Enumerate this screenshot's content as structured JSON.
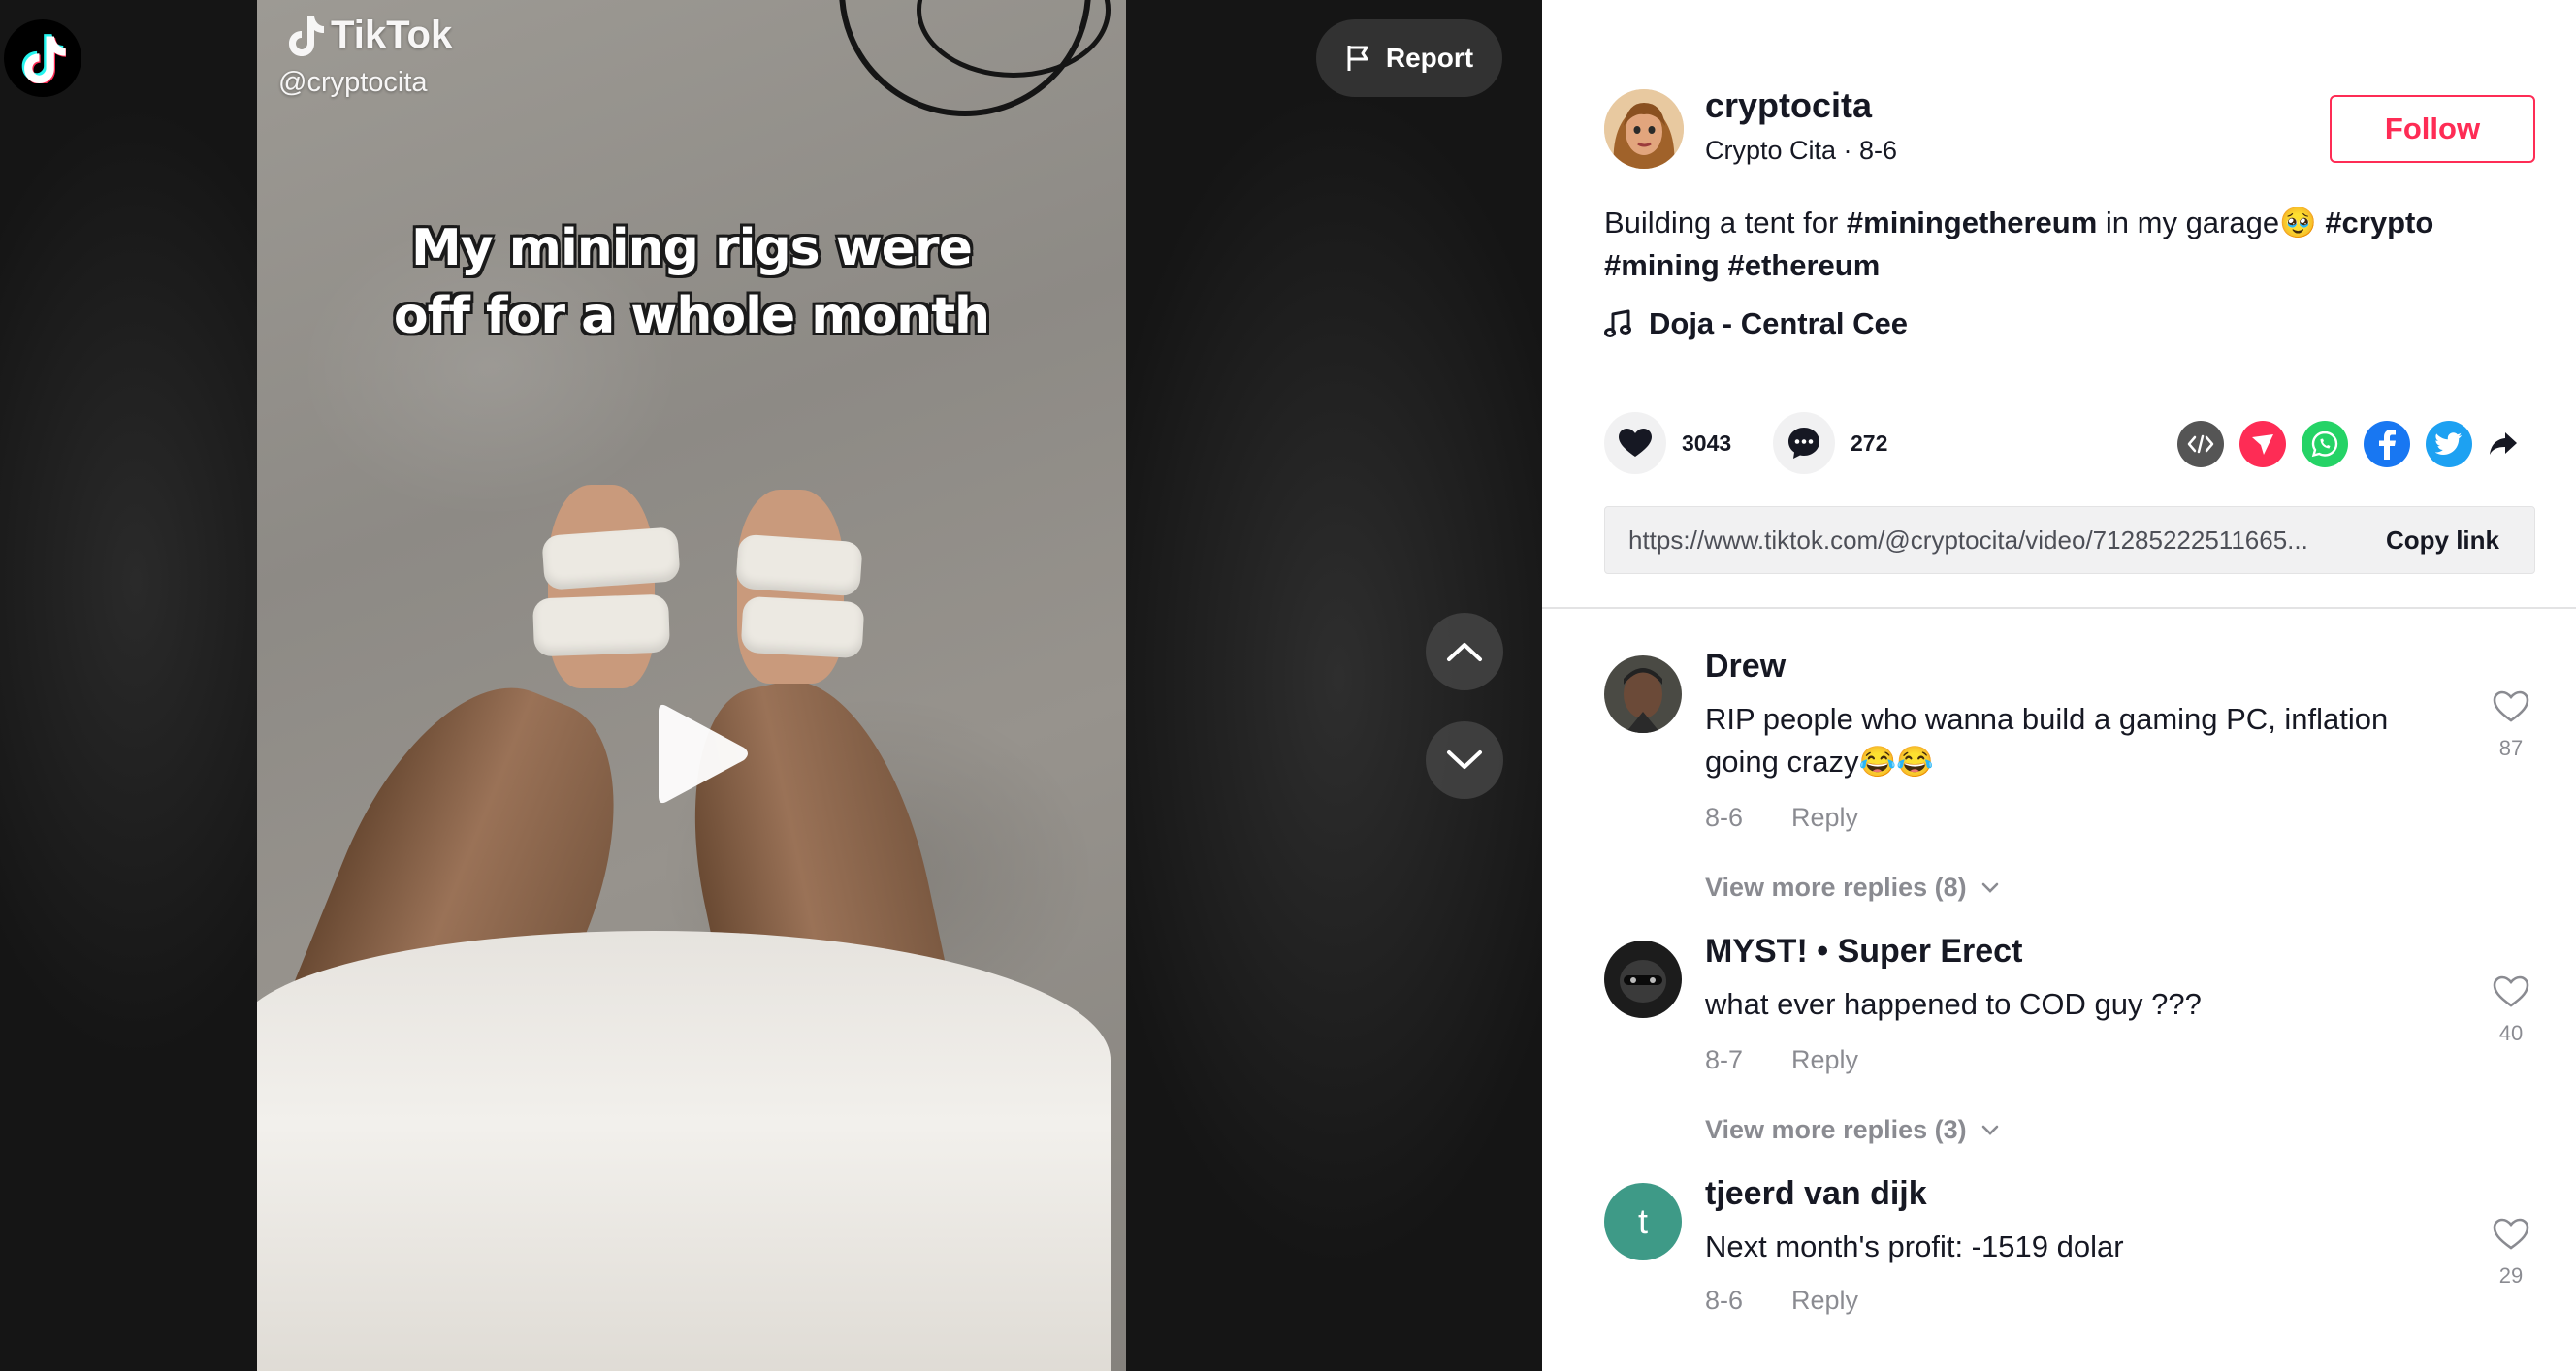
{
  "video": {
    "watermark_brand": "TikTok",
    "watermark_handle": "@cryptocita",
    "caption_line1": "My mining rigs were",
    "caption_line2": "off for a whole month",
    "report_label": "Report"
  },
  "author": {
    "username": "cryptocita",
    "meta": "Crypto Cita · 8-6",
    "follow_label": "Follow"
  },
  "post": {
    "desc_text1": "Building a tent for ",
    "desc_tag1": "#miningethereum",
    "desc_text2": " in my garage🥹 ",
    "desc_tag2": "#crypto",
    "desc_tag3": "#mining",
    "desc_tag4": "#ethereum",
    "music": "Doja - Central Cee",
    "likes": "3043",
    "comments": "272",
    "link_url": "https://www.tiktok.com/@cryptocita/video/71285222511665...",
    "copy_label": "Copy link"
  },
  "share_icons": [
    "embed-icon",
    "send-icon",
    "whatsapp-icon",
    "facebook-icon",
    "twitter-icon",
    "share-arrow-icon"
  ],
  "colors": {
    "accent": "#fe2c55",
    "text": "#161823",
    "muted": "#8a8b91",
    "whatsapp": "#25d366",
    "facebook": "#1877f2",
    "twitter": "#1da1f2",
    "send": "#fe2c55"
  },
  "comments_list": [
    {
      "name": "Drew",
      "text": "RIP people who wanna build a gaming PC, inflation going crazy😂😂",
      "date": "8-6",
      "reply": "Reply",
      "likes": "87",
      "more": "View more replies (8)"
    },
    {
      "name": "MYST! • Super Erect",
      "text": "what ever happened to COD guy ???",
      "date": "8-7",
      "reply": "Reply",
      "likes": "40",
      "more": "View more replies (3)"
    },
    {
      "name": "tjeerd van dijk",
      "initial": "t",
      "text": "Next month's profit: -1519 dolar",
      "date": "8-6",
      "reply": "Reply",
      "likes": "29"
    }
  ]
}
